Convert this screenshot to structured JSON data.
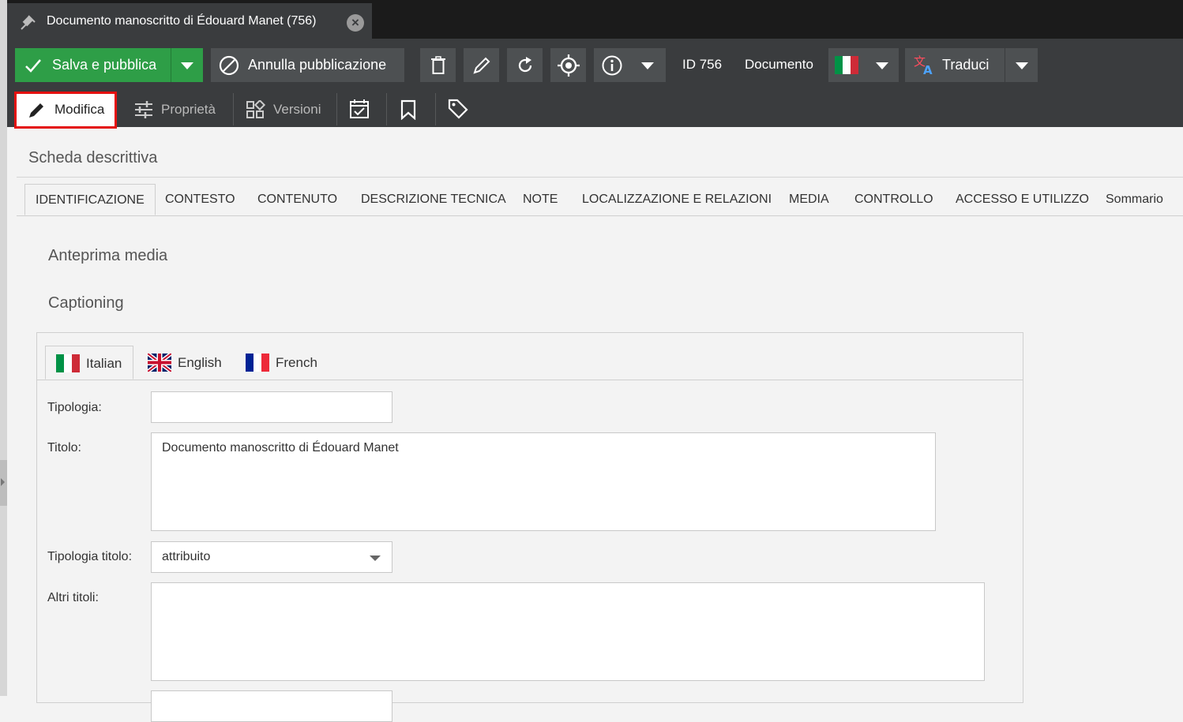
{
  "window": {
    "title": "Documento manoscritto di Édouard Manet (756)"
  },
  "toolbar": {
    "save_label": "Salva e pubblica",
    "unpublish_label": "Annulla pubblicazione",
    "id_label": "ID 756",
    "type_label": "Documento",
    "translate_label": "Traduci"
  },
  "subtoolbar": {
    "modifica": "Modifica",
    "proprieta": "Proprietà",
    "versioni": "Versioni"
  },
  "section_title": "Scheda descrittiva",
  "form_tabs": [
    "IDENTIFICAZIONE",
    "CONTESTO",
    "CONTENUTO",
    "DESCRIZIONE TECNICA",
    "NOTE",
    "LOCALIZZAZIONE E RELAZIONI",
    "MEDIA",
    "CONTROLLO",
    "ACCESSO E UTILIZZO",
    "Sommario"
  ],
  "subsections": {
    "media_preview": "Anteprima media",
    "captioning": "Captioning"
  },
  "language_tabs": [
    "Italian",
    "English",
    "French"
  ],
  "fields": {
    "tipologia": {
      "label": "Tipologia:",
      "value": ""
    },
    "titolo": {
      "label": "Titolo:",
      "value": "Documento manoscritto di Édouard Manet"
    },
    "tipologia_titolo": {
      "label": "Tipologia titolo:",
      "value": "attribuito"
    },
    "altri_titoli": {
      "label": "Altri titoli:",
      "value": ""
    }
  },
  "colors": {
    "accent_green": "#2e9e47",
    "toolbar": "#3a3c3e",
    "highlight_red": "#e4100f"
  }
}
